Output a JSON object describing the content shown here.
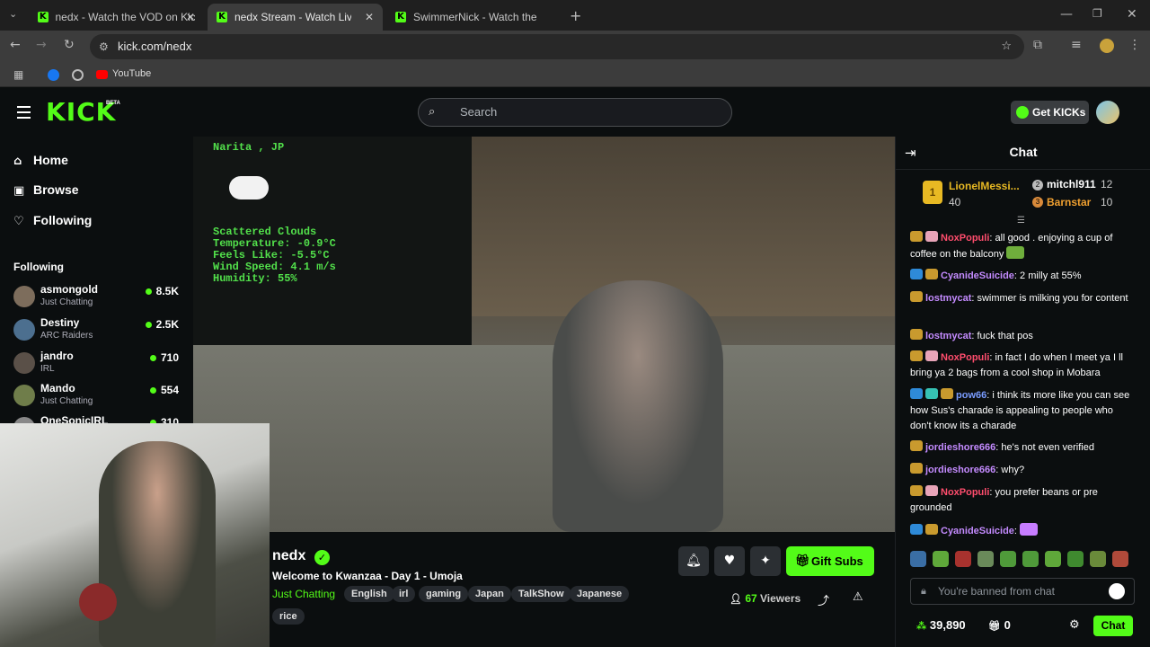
{
  "browser": {
    "tabs": [
      {
        "title": "nedx - Watch the VOD on Kick",
        "active": false
      },
      {
        "title": "nedx Stream - Watch Live o",
        "active": true
      },
      {
        "title": "SwimmerNick - Watch the VOD",
        "active": false
      }
    ],
    "url": "kick.com/nedx",
    "bookmarks": [
      {
        "label": "YouTube"
      }
    ]
  },
  "header": {
    "logo": "KICK",
    "logo_badge": "BETA",
    "search_placeholder": "Search",
    "get_kicks_label": "Get KICKs"
  },
  "sidebar": {
    "nav": [
      {
        "label": "Home",
        "icon": "home-icon"
      },
      {
        "label": "Browse",
        "icon": "browse-icon"
      },
      {
        "label": "Following",
        "icon": "heart-icon"
      }
    ],
    "following_title": "Following",
    "following": [
      {
        "name": "asmongold",
        "category": "Just Chatting",
        "viewers": "8.5K"
      },
      {
        "name": "Destiny",
        "category": "ARC Raiders",
        "viewers": "2.5K"
      },
      {
        "name": "jandro",
        "category": "IRL",
        "viewers": "710"
      },
      {
        "name": "Mando",
        "category": "Just Chatting",
        "viewers": "554"
      },
      {
        "name": "OneSonicIRL",
        "category": "",
        "viewers": "310"
      }
    ]
  },
  "weather": {
    "location": "Narita , JP",
    "condition": "Scattered Clouds",
    "temperature": "Temperature: -0.9°C",
    "feels_like": "Feels Like: -5.5°C",
    "wind": "Wind Speed: 4.1 m/s",
    "humidity": "Humidity: 55%"
  },
  "stream": {
    "channel": "nedx",
    "title": "Welcome to Kwanzaa - Day 1 - Umoja",
    "category": "Just Chatting",
    "tags": [
      "English",
      "irl",
      "gaming",
      "Japan",
      "TalkShow",
      "Japanese",
      "rice"
    ],
    "viewers": "67",
    "viewers_label": "Viewers",
    "gift_subs_label": "Gift Subs"
  },
  "chat": {
    "title": "Chat",
    "leaderboard": [
      {
        "rank": "1",
        "name": "LionelMessi...",
        "count": "40"
      },
      {
        "rank": "2",
        "name": "mitchl911",
        "count": "12"
      },
      {
        "rank": "3",
        "name": "Barnstar",
        "count": "10"
      }
    ],
    "messages": [
      {
        "user": "NoxPopuli",
        "text": ": all good . enjoying a cup of coffee on the balcony"
      },
      {
        "user": "CyanideSuicide",
        "text": ": 2 milly at 55%"
      },
      {
        "user": "lostmycat",
        "text": ": swimmer is milking you for content"
      },
      {
        "user": "lostmycat",
        "text": ": fuck that pos"
      },
      {
        "user": "NoxPopuli",
        "text": ": in fact I do when I meet ya I ll bring ya 2 bags from a cool shop in Mobara"
      },
      {
        "user": "pow66",
        "text": ": i think its more like you can see how Sus's charade is appealing to people who don't know its a charade"
      },
      {
        "user": "jordieshore666",
        "text": ": he's not even verified"
      },
      {
        "user": "jordieshore666",
        "text": ": why?"
      },
      {
        "user": "NoxPopuli",
        "text": ": you prefer beans or pre grounded"
      },
      {
        "user": "CyanideSuicide",
        "text": ":"
      }
    ],
    "input_placeholder": "You're banned from chat",
    "points": "39,890",
    "gifts": "0",
    "send_label": "Chat"
  }
}
